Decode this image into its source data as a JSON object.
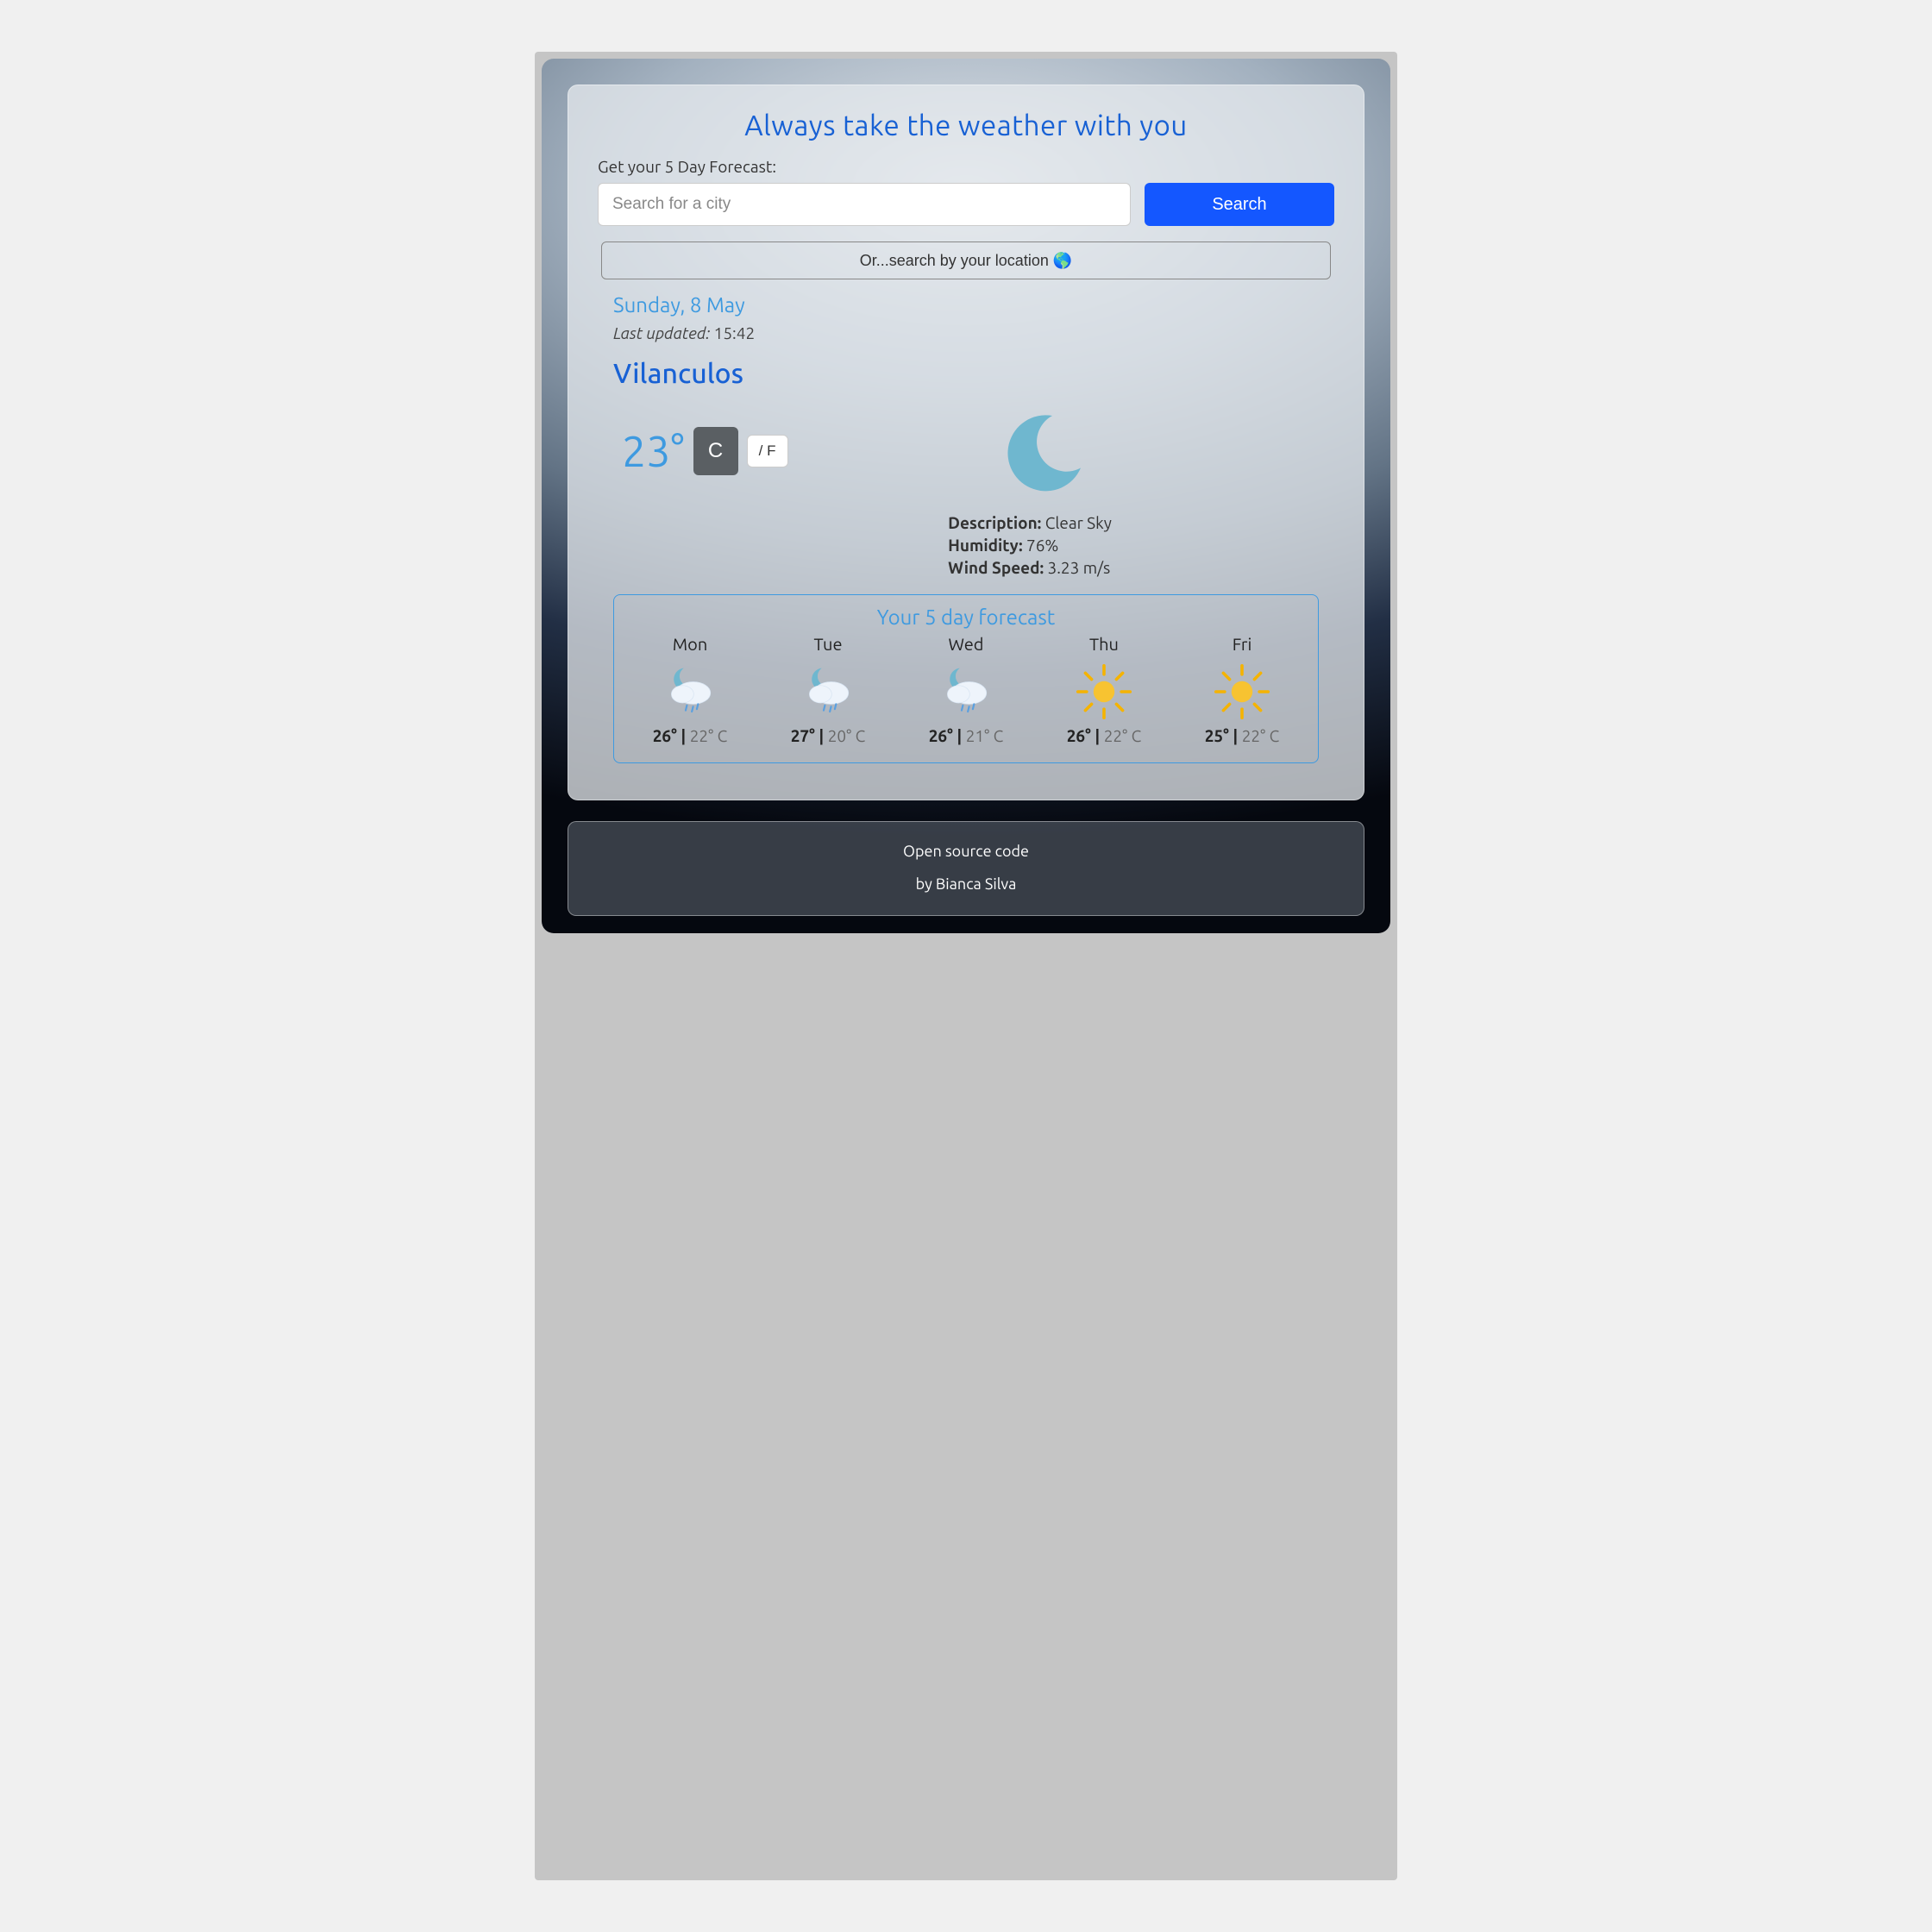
{
  "header": {
    "title": "Always take the weather with you",
    "prompt": "Get your 5 Day Forecast:"
  },
  "search": {
    "placeholder": "Search for a city",
    "button_label": "Search"
  },
  "location_button": "Or...search by your location 🌎",
  "overview": {
    "date": "Sunday, 8 May",
    "updated_label": "Last updated:",
    "updated_time": "15:42",
    "city": "Vilanculos",
    "temp": "23°",
    "unit_c_label": "C",
    "unit_f_label": "/ F",
    "meta": {
      "description_label": "Description:",
      "description_value": "Clear Sky",
      "humidity_label": "Humidity:",
      "humidity_value": "76%",
      "wind_label": "Wind Speed:",
      "wind_value": "3.23 m/s"
    },
    "icon": "clear-night"
  },
  "forecast": {
    "title": "Your 5 day forecast",
    "days": [
      {
        "day": "Mon",
        "icon": "night-rain",
        "hi": "26°",
        "lo": "22° C"
      },
      {
        "day": "Tue",
        "icon": "night-rain",
        "hi": "27°",
        "lo": "20° C"
      },
      {
        "day": "Wed",
        "icon": "night-rain",
        "hi": "26°",
        "lo": "21° C"
      },
      {
        "day": "Thu",
        "icon": "sunny",
        "hi": "26°",
        "lo": "22° C"
      },
      {
        "day": "Fri",
        "icon": "sunny",
        "hi": "25°",
        "lo": "22° C"
      }
    ]
  },
  "footer": {
    "line1": "Open source code",
    "line2": "by Bianca Silva"
  },
  "colors": {
    "accent_blue": "#1861d4",
    "link_blue": "#3e9ae0",
    "btn_blue": "#1457ff"
  }
}
